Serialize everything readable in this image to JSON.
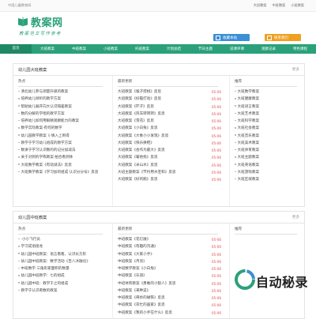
{
  "topbar": {
    "welcome": "中国儿童教育网",
    "links": [
      "大班教案",
      "中班教案",
      "小班教案"
    ]
  },
  "header": {
    "logo_text": "教案网",
    "slogan": "教案范文写作参考",
    "btn_a": "收藏本站",
    "btn_b": "联系我们"
  },
  "nav": {
    "items": [
      "首页",
      "大班教案",
      "中班教案",
      "小班教案",
      "托班教案",
      "计划总结",
      "节日主题",
      "说课评课",
      "观察记录",
      "特色课程"
    ]
  },
  "panel1": {
    "title": "幼儿园大班教案",
    "more": "更多",
    "col1": {
      "head": "热点",
      "items": [
        "清北幼儿参与测量升级的教案",
        "培养幼儿倾听的教学方案",
        "帮助幼儿展开向大认识隔差教案",
        "数的分解的学唱的教学方案",
        "培养幼儿如何用眼睛观察能力的教案",
        "数学实际教案·有何的数学",
        "幼儿园教学教案《·填入上到得",
        "教学于学习幼儿组成的教学方案",
        "数讲于学习认识数的的记分加减法",
        "关于对到的学练教案·拍合看到体",
        "大班数学教案《有动减法》反思",
        "大班数学教案《学习加的组成 认识分分号》反思"
      ]
    },
    "col2": {
      "head": "最新更新",
      "items": [
        {
          "t": "大班教案《猴子捞桃》反思",
          "d": "05-06"
        },
        {
          "t": "大班教案《好脑打动》反思",
          "d": "05-06"
        },
        {
          "t": "大班教案《吓子》反思",
          "d": "05-06"
        },
        {
          "t": "大班教案《风车转转转》反思",
          "d": "05-06"
        },
        {
          "t": "大班教案《雪花》反思",
          "d": "05-06"
        },
        {
          "t": "大班教案《小白兔》反思",
          "d": "05-06"
        },
        {
          "t": "大班教案《大象小小发现》反思",
          "d": "05-06"
        },
        {
          "t": "大班教案《快乐换鞋》",
          "d": "05-06"
        },
        {
          "t": "大班教案《会作为最大》反思",
          "d": "05-06"
        },
        {
          "t": "大班教案《葡他找》反思",
          "d": "05-06"
        },
        {
          "t": "大班教案《米山水》反思",
          "d": "05-06"
        },
        {
          "t": "大班主题教案《节约用水宝和》反思",
          "d": "05-06"
        },
        {
          "t": "大班教案《好的鹅》反思",
          "d": "05-06"
        }
      ]
    },
    "col3": {
      "head": "推荐",
      "items": [
        "大班数学教案",
        "大班健康教案",
        "大班语言教案",
        "大班艺术教案",
        "大班科学教案",
        "大班社会教案",
        "大班音乐教案",
        "大班美术教案",
        "大班体育教案",
        "大班主题教案",
        "大班英语教案",
        "大班游戏教案",
        "大班区域教案"
      ]
    }
  },
  "panel2": {
    "title": "幼儿园中班教案",
    "more": "更多",
    "col1": {
      "head": "热点",
      "items": [
        "·小小飞行员",
        "学习成语接龙",
        "幼儿园中班教案：语言看看，认识长方形",
        "幼儿园中班教案：数学活动《百八冰融化》",
        "中班数学 三角形家面积的数量",
        "幼儿园中班教学：七的组成",
        "幼儿园中班：教学于之的组成",
        "教学于认识奇数的教案"
      ]
    },
    "col2": {
      "head": "最新更新",
      "items": [
        {
          "t": "中班教案《花灯展》",
          "d": "05-06"
        },
        {
          "t": "中班教案《有趣的沟通》",
          "d": "05-06"
        },
        {
          "t": "中班教案《大家小手》",
          "d": "05-06"
        },
        {
          "t": "中班教案《月亮》",
          "d": "05-06"
        },
        {
          "t": "中班数学教案《小白兔》",
          "d": "05-06"
        },
        {
          "t": "中班教案《乐道》",
          "d": "05-06"
        },
        {
          "t": "中班体育教案《勇敢的小狼人》反思",
          "d": "05-06"
        },
        {
          "t": "中班教案《来种菜》",
          "d": "05-06"
        },
        {
          "t": "中班教案《奇妙的磁铁》反思",
          "d": "05-06"
        },
        {
          "t": "中班教案《农忙的画家》反思",
          "d": "05-06"
        },
        {
          "t": "中班教案《我的小手在什么》反思",
          "d": "05-06"
        }
      ]
    },
    "col3": {
      "head": "推荐",
      "items": []
    }
  },
  "watermark": {
    "text": "自动秘录",
    "sub": "自动秘录"
  },
  "colors": {
    "brand": "#2aa17a",
    "brand_dark": "#1f8865",
    "btn_blue": "#3a8fd6",
    "btn_orange": "#f0a020",
    "date_red": "#e05050"
  }
}
